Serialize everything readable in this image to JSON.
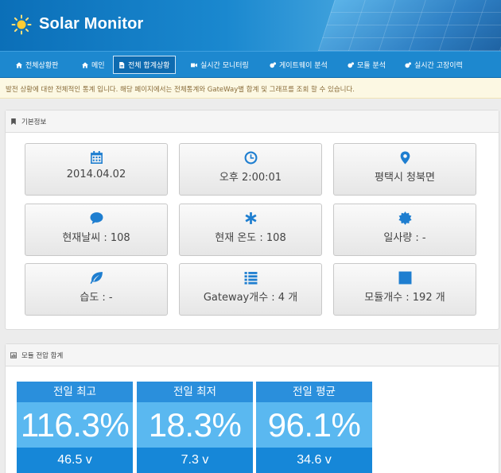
{
  "app": {
    "title": "Solar Monitor",
    "logo_icon": "sun-icon"
  },
  "nav": [
    {
      "label": "전체상황판",
      "icon": "home-icon"
    },
    {
      "label": "메인",
      "icon": "home-icon"
    },
    {
      "label": "전체 합계상황",
      "icon": "document-icon",
      "active": true
    },
    {
      "label": "실시간 모니터링",
      "icon": "video-icon"
    },
    {
      "label": "게이트웨이 분석",
      "icon": "cogs-icon"
    },
    {
      "label": "모듈 분석",
      "icon": "cogs-icon"
    },
    {
      "label": "실시간 고장이력",
      "icon": "cogs-icon"
    }
  ],
  "notice": "발전 상황에 대한 전체적인 통계 입니다. 해당 페이지에서는 전체통계와 GateWay별 합계 및 그래프를 조회 할 수 있습니다.",
  "basic": {
    "title": "기본정보",
    "tiles": [
      {
        "icon": "calendar-icon",
        "value": "2014.04.02"
      },
      {
        "icon": "clock-icon",
        "value": "오후 2:00:01"
      },
      {
        "icon": "map-marker-icon",
        "value": "평택시 청북면"
      },
      {
        "icon": "comment-icon",
        "value": "현재날씨 : 108"
      },
      {
        "icon": "asterisk-icon",
        "value": "현재 온도 : 108"
      },
      {
        "icon": "sun-badge-icon",
        "value": "일사량 : -"
      },
      {
        "icon": "leaf-icon",
        "value": "습도 : -"
      },
      {
        "icon": "list-icon",
        "value": "Gateway개수 : 4 개"
      },
      {
        "icon": "square-icon",
        "value": "모듈개수 : 192 개"
      }
    ]
  },
  "module": {
    "title": "모듈 전압 합계",
    "stats": [
      {
        "title": "전일 최고",
        "percent": "116.3%",
        "volt": "46.5 v"
      },
      {
        "title": "전일 최저",
        "percent": "18.3%",
        "volt": "7.3 v"
      },
      {
        "title": "전일 평균",
        "percent": "96.1%",
        "volt": "34.6 v"
      }
    ]
  },
  "colors": {
    "header": "#1a88cf",
    "nav": "#1d88cf",
    "accent": "#1e7ed0",
    "stat_title": "#2a8fdc",
    "stat_body": "#5ab8f0",
    "notice_bg": "#fcf8e3"
  }
}
